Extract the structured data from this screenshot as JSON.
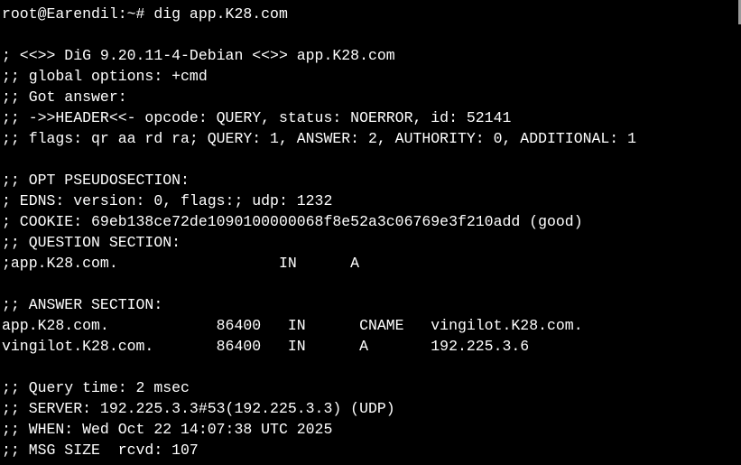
{
  "terminal": {
    "lines": [
      "root@Earendil:~# dig app.K28.com",
      "",
      "; <<>> DiG 9.20.11-4-Debian <<>> app.K28.com",
      ";; global options: +cmd",
      ";; Got answer:",
      ";; ->>HEADER<<- opcode: QUERY, status: NOERROR, id: 52141",
      ";; flags: qr aa rd ra; QUERY: 1, ANSWER: 2, AUTHORITY: 0, ADDITIONAL: 1",
      "",
      ";; OPT PSEUDOSECTION:",
      "; EDNS: version: 0, flags:; udp: 1232",
      "; COOKIE: 69eb138ce72de1090100000068f8e52a3c06769e3f210add (good)",
      ";; QUESTION SECTION:",
      ";app.K28.com.                  IN      A",
      "",
      ";; ANSWER SECTION:",
      "app.K28.com.            86400   IN      CNAME   vingilot.K28.com.",
      "vingilot.K28.com.       86400   IN      A       192.225.3.6",
      "",
      ";; Query time: 2 msec",
      ";; SERVER: 192.225.3.3#53(192.225.3.3) (UDP)",
      ";; WHEN: Wed Oct 22 14:07:38 UTC 2025",
      ";; MSG SIZE  rcvd: 107"
    ]
  }
}
